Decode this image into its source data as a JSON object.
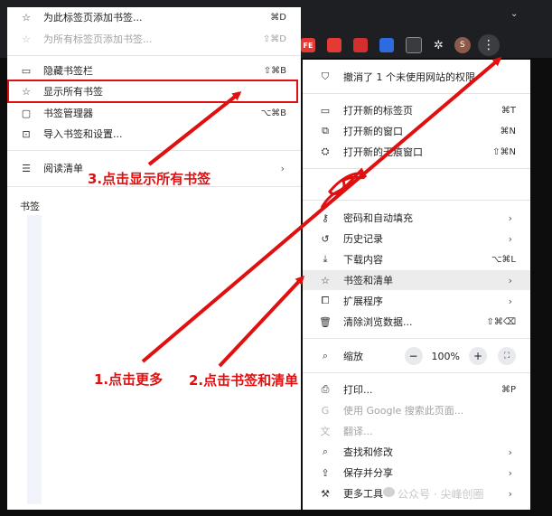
{
  "colors": {
    "annotation": "#e01010",
    "menu_bg": "#ffffff",
    "chrome_bg": "#1e1f22"
  },
  "toolbar": {
    "ext_labels": [
      "FE",
      "",
      "",
      "",
      ""
    ],
    "avatar": "S",
    "menu_glyph": "⋮",
    "chevron": "⌄"
  },
  "bookmarks_menu": {
    "items": [
      {
        "icon": "star-icon",
        "glyph": "☆",
        "label": "为此标签页添加书签...",
        "shortcut": "⌘D",
        "disabled": false
      },
      {
        "icon": "star-plus-icon",
        "glyph": "☆",
        "label": "为所有标签页添加书签...",
        "shortcut": "⇧⌘D",
        "disabled": true
      },
      {
        "icon": "bookmark-bar-icon",
        "glyph": "▭",
        "label": "隐藏书签栏",
        "shortcut": "⇧⌘B",
        "disabled": false
      },
      {
        "icon": "star-list-icon",
        "glyph": "☆",
        "label": "显示所有书签",
        "shortcut": "",
        "disabled": false
      },
      {
        "icon": "bookmark-manager-icon",
        "glyph": "▢",
        "label": "书签管理器",
        "shortcut": "⌥⌘B",
        "disabled": false
      },
      {
        "icon": "import-icon",
        "glyph": "⊡",
        "label": "导入书签和设置...",
        "shortcut": "",
        "disabled": false
      },
      {
        "icon": "reading-list-icon",
        "glyph": "☰",
        "label": "阅读清单",
        "shortcut": "",
        "arrow": "›",
        "disabled": false
      }
    ],
    "section_header": "书签"
  },
  "main_menu": {
    "items": [
      {
        "icon": "shield-icon",
        "glyph": "⛉",
        "label": "撤消了 1 个未使用网站的权限",
        "shortcut": ""
      },
      {
        "icon": "new-tab-icon",
        "glyph": "▭",
        "label": "打开新的标签页",
        "shortcut": "⌘T"
      },
      {
        "icon": "new-window-icon",
        "glyph": "⧉",
        "label": "打开新的窗口",
        "shortcut": "⌘N"
      },
      {
        "icon": "incognito-icon",
        "glyph": "⛭",
        "label": "打开新的无痕窗口",
        "shortcut": "⇧⌘N"
      },
      {
        "icon": "key-icon",
        "glyph": "⚷",
        "label": "密码和自动填充",
        "arrow": "›"
      },
      {
        "icon": "history-icon",
        "glyph": "↺",
        "label": "历史记录",
        "arrow": "›"
      },
      {
        "icon": "download-icon",
        "glyph": "⤓",
        "label": "下载内容",
        "shortcut": "⌥⌘L"
      },
      {
        "icon": "star-icon",
        "glyph": "☆",
        "label": "书签和清单",
        "arrow": "›"
      },
      {
        "icon": "extension-icon",
        "glyph": "⧠",
        "label": "扩展程序",
        "arrow": "›"
      },
      {
        "icon": "trash-icon",
        "glyph": "🗑",
        "label": "清除浏览数据...",
        "shortcut": "⇧⌘⌫"
      },
      {
        "icon": "zoom-icon",
        "glyph": "⌕",
        "label": "缩放"
      },
      {
        "icon": "print-icon",
        "glyph": "⎙",
        "label": "打印...",
        "shortcut": "⌘P"
      },
      {
        "icon": "google-icon",
        "glyph": "G",
        "label": "使用 Google 搜索此页面...",
        "disabled": true
      },
      {
        "icon": "translate-icon",
        "glyph": "文",
        "label": "翻译...",
        "disabled": true
      },
      {
        "icon": "find-icon",
        "glyph": "⌕",
        "label": "查找和修改",
        "arrow": "›"
      },
      {
        "icon": "save-share-icon",
        "glyph": "⇪",
        "label": "保存并分享",
        "arrow": "›"
      },
      {
        "icon": "toolbox-icon",
        "glyph": "⚒",
        "label": "更多工具",
        "arrow": "›"
      }
    ],
    "zoom": {
      "minus": "−",
      "value": "100%",
      "plus": "+",
      "fullscreen": "⛶"
    }
  },
  "annotations": {
    "step1": "1.点击更多",
    "step2": "2.点击书签和清单",
    "step3": "3.点击显示所有书签"
  },
  "watermark": "公众号 · 尖峰创圈"
}
